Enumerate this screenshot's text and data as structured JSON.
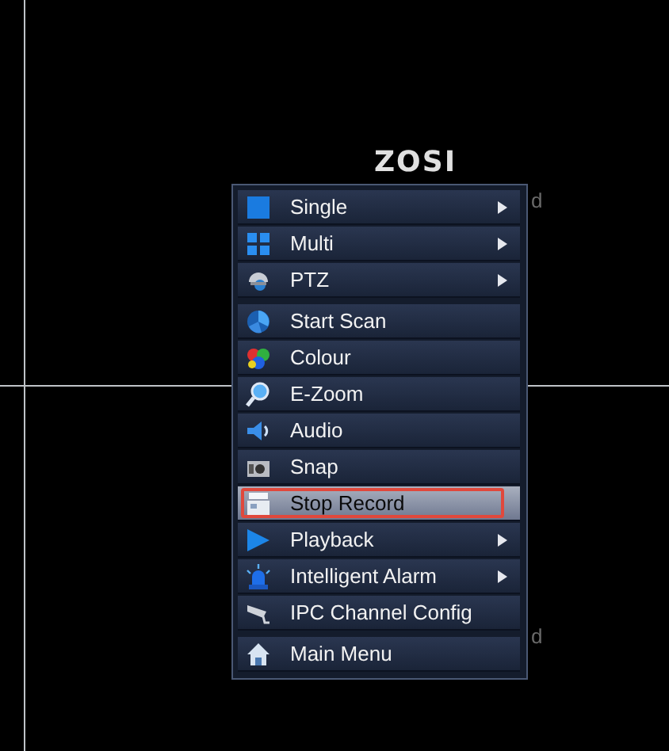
{
  "logo": "ZOSI",
  "edge_labels": [
    "d",
    "d"
  ],
  "menu": {
    "groups": [
      [
        {
          "label": "Single",
          "kind": "square",
          "submenu": true,
          "selected": false
        },
        {
          "label": "Multi",
          "kind": "grid",
          "submenu": true,
          "selected": false
        },
        {
          "label": "PTZ",
          "kind": "dome",
          "submenu": true,
          "selected": false
        }
      ],
      [
        {
          "label": "Start Scan",
          "kind": "scan",
          "submenu": false,
          "selected": false
        },
        {
          "label": "Colour",
          "kind": "colour",
          "submenu": false,
          "selected": false
        },
        {
          "label": "E-Zoom",
          "kind": "magnifier",
          "submenu": false,
          "selected": false
        },
        {
          "label": "Audio",
          "kind": "speaker",
          "submenu": false,
          "selected": false
        },
        {
          "label": "Snap",
          "kind": "camera",
          "submenu": false,
          "selected": false
        },
        {
          "label": "Stop Record",
          "kind": "film",
          "submenu": false,
          "selected": true
        },
        {
          "label": "Playback",
          "kind": "play",
          "submenu": true,
          "selected": false
        },
        {
          "label": "Intelligent Alarm",
          "kind": "alarm",
          "submenu": true,
          "selected": false
        },
        {
          "label": "IPC Channel Config",
          "kind": "cctv",
          "submenu": false,
          "selected": false
        }
      ],
      [
        {
          "label": "Main Menu",
          "kind": "home",
          "submenu": false,
          "selected": false
        }
      ]
    ]
  }
}
